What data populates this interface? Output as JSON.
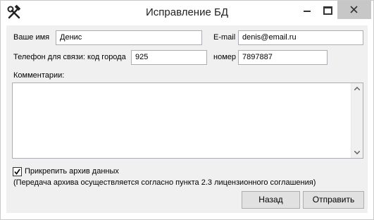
{
  "window": {
    "title": "Исправление БД",
    "icon": "hammer-wrench-icon"
  },
  "form": {
    "name_label": "Ваше имя",
    "name_value": "Денис",
    "email_label": "E-mail",
    "email_value": "denis@email.ru",
    "phone_label": "Телефон для связи: код города",
    "area_code_value": "925",
    "number_label": "номер",
    "number_value": "7897887",
    "comments_label": "Комментарии:",
    "comments_value": ""
  },
  "attach": {
    "label": "Прикрепить архив данных",
    "checked": true,
    "note": "(Передача архива осуществляется согласно пункта 2.3 лицензионного соглашения)"
  },
  "buttons": {
    "back": "Назад",
    "send": "Отправить"
  }
}
